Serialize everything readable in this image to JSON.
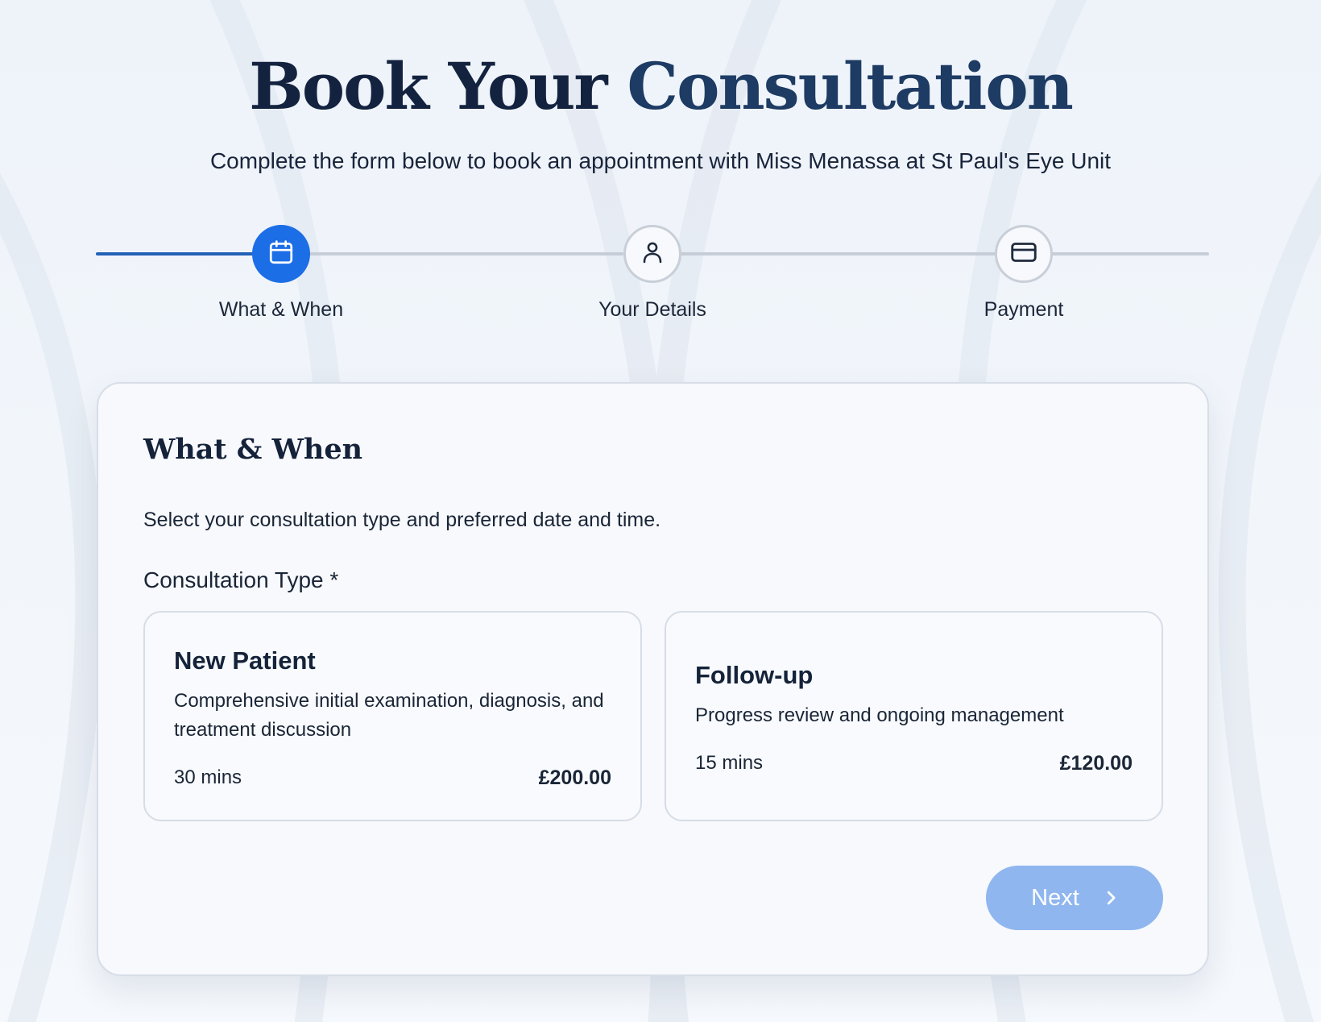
{
  "header": {
    "title_part1": "Book Your ",
    "title_part2": "Consultation",
    "subtitle": "Complete the form below to book an appointment with Miss Menassa at St Paul's Eye Unit"
  },
  "stepper": {
    "steps": [
      {
        "label": "What & When",
        "icon": "calendar-icon",
        "state": "active"
      },
      {
        "label": "Your Details",
        "icon": "user-icon",
        "state": "pending"
      },
      {
        "label": "Payment",
        "icon": "credit-card-icon",
        "state": "pending"
      }
    ]
  },
  "form": {
    "section_title": "What & When",
    "section_description": "Select your consultation type and preferred date and time.",
    "consultation_type_label": "Consultation Type *",
    "options": [
      {
        "title": "New Patient",
        "description": "Comprehensive initial examination, diagnosis, and treatment discussion",
        "duration": "30 mins",
        "price": "£200.00"
      },
      {
        "title": "Follow-up",
        "description": "Progress review and ongoing management",
        "duration": "15 mins",
        "price": "£120.00"
      }
    ],
    "next_label": "Next",
    "next_icon": "chevron-right-icon"
  },
  "colors": {
    "accent": "#1c6ee6",
    "progress": "#2261b8",
    "next_disabled": "#8fb6ef",
    "title_dark": "#13233f"
  }
}
